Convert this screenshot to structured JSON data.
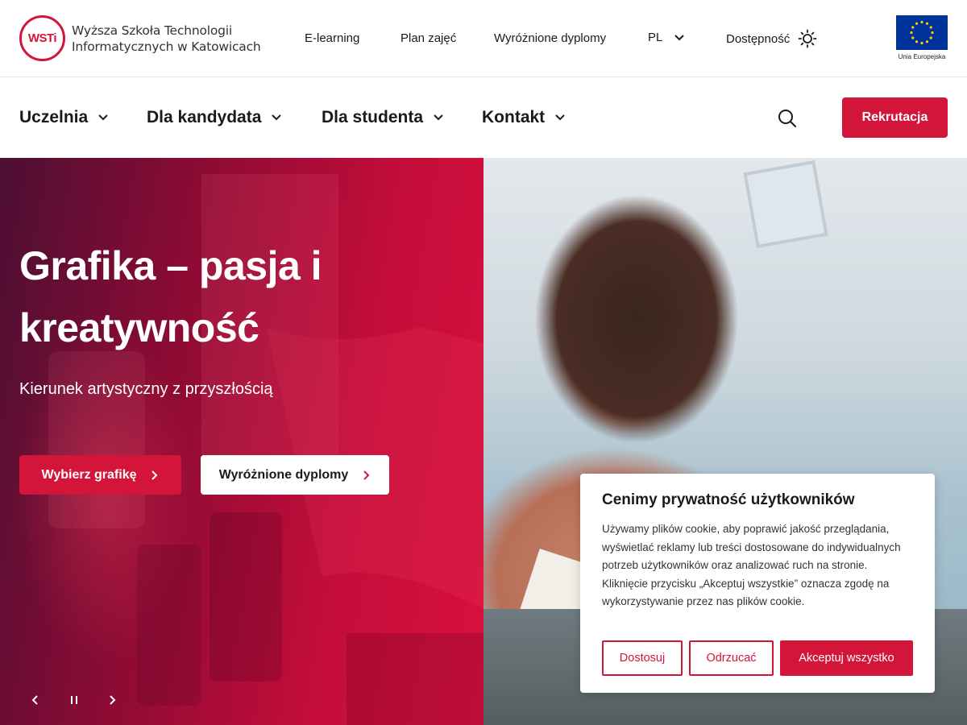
{
  "logo": {
    "mark": "WSTi",
    "name_line1": "Wyższa Szkoła Technologii",
    "name_line2": "Informatycznych w Katowicach"
  },
  "utility_nav": {
    "elearning": "E-learning",
    "schedule": "Plan zajęć",
    "diplomas": "Wyróżnione dyplomy",
    "language": "PL",
    "accessibility": "Dostępność"
  },
  "eu": {
    "label": "Unia Europejska"
  },
  "main_nav": {
    "items": [
      {
        "label": "Uczelnia"
      },
      {
        "label": "Dla kandydata"
      },
      {
        "label": "Dla studenta"
      },
      {
        "label": "Kontakt"
      }
    ],
    "cta": "Rekrutacja"
  },
  "hero": {
    "title": "Grafika – pasja i kreatywność",
    "subtitle": "Kierunek artystyczny z przyszłością",
    "primary_button": "Wybierz grafikę",
    "secondary_button": "Wyróżnione dyplomy"
  },
  "cookie": {
    "title": "Cenimy prywatność użytkowników",
    "text": "Używamy plików cookie, aby poprawić jakość przeglądania, wyświetlać reklamy lub treści dostosowane do indywidualnych potrzeb użytkowników oraz analizować ruch na stronie. Kliknięcie przycisku „Akceptuj wszystkie” oznacza zgodę na wykorzystywanie przez nas plików cookie.",
    "customize": "Dostosuj",
    "reject": "Odrzucać",
    "accept": "Akceptuj wszystko"
  },
  "colors": {
    "brand": "#d4153a",
    "eu_blue": "#003399",
    "eu_star": "#ffcc00"
  }
}
